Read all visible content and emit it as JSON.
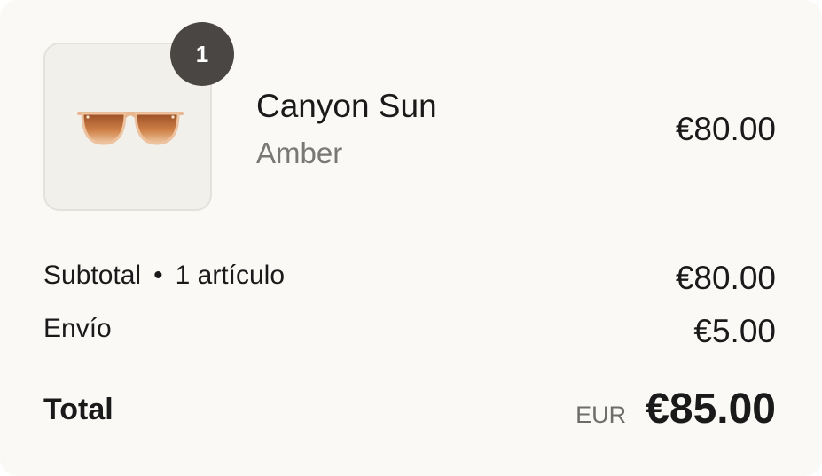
{
  "item": {
    "quantity": "1",
    "name": "Canyon Sun",
    "variant": "Amber",
    "price": "€80.00",
    "image_icon": "sunglasses-icon"
  },
  "summary": {
    "subtotal_label": "Subtotal",
    "separator": "•",
    "item_count": "1 artículo",
    "subtotal_value": "€80.00",
    "shipping_label": "Envío",
    "shipping_value": "€5.00",
    "total_label": "Total",
    "currency_code": "EUR",
    "total_value": "€85.00"
  },
  "colors": {
    "card_background": "#faf9f6",
    "badge_background": "#494644",
    "lens_amber": "#c9763a",
    "frame": "#e8b68f"
  }
}
